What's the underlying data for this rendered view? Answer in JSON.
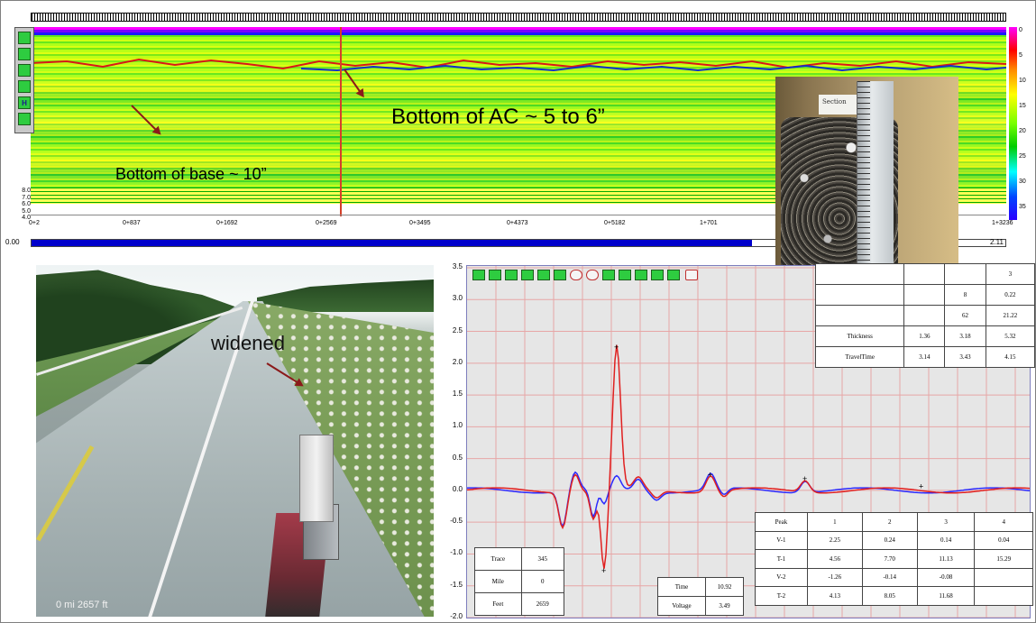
{
  "radargram": {
    "annotation_ac": "Bottom of AC ~ 5 to 6”",
    "annotation_base": "Bottom of base ~ 10”",
    "left_axis": [
      "8.0",
      "7.0",
      "6.0",
      "5.0",
      "4.0"
    ],
    "stations": [
      "0+2",
      "0+837",
      "0+1692",
      "0+2569",
      "0+3495",
      "0+4373",
      "0+5182",
      "1+701",
      "1+3236"
    ],
    "scroll_left_value": "0.00",
    "scroll_right_value": "2.11",
    "scroll_progress": 0.74,
    "colorbar_ticks": [
      "0",
      "5",
      "10",
      "15",
      "20",
      "25",
      "30",
      "35"
    ],
    "tool_icons": [
      "ruler-icon",
      "cross-arrows-icon",
      "crosshair-icon",
      "x-box-icon",
      "h-icon",
      "x-icon"
    ],
    "tool_labels": [
      "",
      "",
      "",
      "",
      "H",
      ""
    ]
  },
  "core_photo": {
    "label": "Section"
  },
  "road_photo": {
    "label": "widened",
    "footer": "0 mi  2657 ft"
  },
  "waveform": {
    "y_ticks": [
      "3.5",
      "3.0",
      "2.5",
      "2.0",
      "1.5",
      "1.0",
      "0.5",
      "0.0",
      "-0.5",
      "-1.0",
      "-1.5",
      "-2.0"
    ],
    "layer_table": {
      "header": [
        "",
        "",
        "",
        "3"
      ],
      "rows": [
        [
          "",
          "",
          "8",
          "0.22"
        ],
        [
          "",
          "",
          "62",
          "21.22"
        ],
        [
          "Thickness",
          "1.36",
          "3.18",
          "5.32"
        ],
        [
          "TravelTime",
          "3.14",
          "3.43",
          "4.15"
        ]
      ]
    },
    "peak_table": {
      "header": [
        "Peak",
        "1",
        "2",
        "3",
        "4"
      ],
      "rows": [
        [
          "V-1",
          "2.25",
          "0.24",
          "0.14",
          "0.04"
        ],
        [
          "T-1",
          "4.56",
          "7.70",
          "11.13",
          "15.29"
        ],
        [
          "V-2",
          "-1.26",
          "-0.14",
          "-0.08",
          ""
        ],
        [
          "T-2",
          "4.13",
          "8.05",
          "11.68",
          ""
        ]
      ]
    },
    "trace_table": [
      [
        "Trace",
        "345"
      ],
      [
        "Mile",
        "0"
      ],
      [
        "Feet",
        "2659"
      ]
    ],
    "time_table": [
      [
        "Time",
        "10.92"
      ],
      [
        "Voltage",
        "3.49"
      ]
    ],
    "colors": {
      "series_red": "#e02020",
      "series_blue": "#2a2aff",
      "grid": "#e7a6a6",
      "background": "#e6e6e6"
    }
  }
}
